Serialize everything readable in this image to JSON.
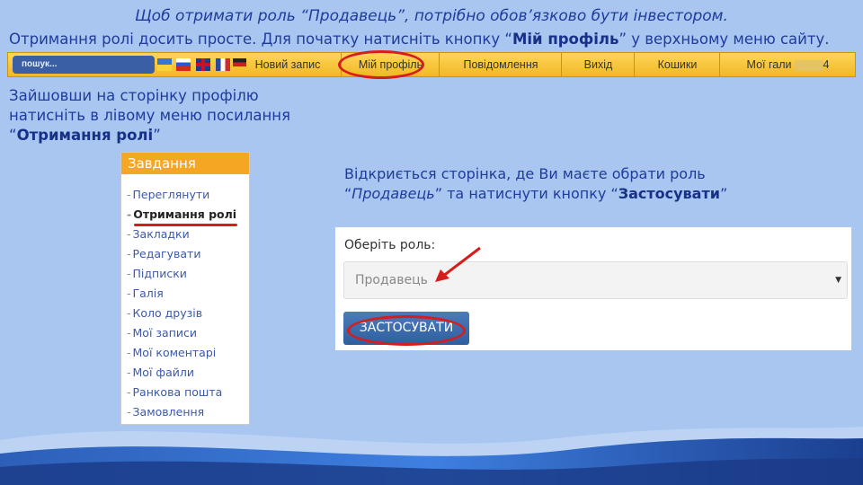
{
  "instructions": {
    "headline": "Щоб отримати роль “Продавець”, потрібно обов’язково бути інвестором.",
    "subline_pre": "Отримання ролі досить просте. Для початку натисніть кнопку “",
    "subline_bold": "Мій профіль",
    "subline_post": "” у верхньому меню сайту.",
    "left_line1": "Зайшовши на сторінку профілю",
    "left_line2": "натисніть в лівому меню посилання",
    "left_line3_pre": "“",
    "left_line3_bold": "Отримання ролі",
    "left_line3_post": "”",
    "right_line1": "Відкриється сторінка, де Ви маєте обрати роль",
    "right_line2_pre": "“",
    "right_line2_italic": "Продавець",
    "right_line2_mid": "” та натиснути кнопку “",
    "right_line2_bold": "Застосувати",
    "right_line2_post": "”"
  },
  "menubar": {
    "search_placeholder": "пошук...",
    "items": [
      {
        "label": "Новий запис"
      },
      {
        "label": "Мій профіль"
      },
      {
        "label": "Повідомлення"
      },
      {
        "label": "Вихід"
      },
      {
        "label": "Кошики"
      },
      {
        "label": "Мої гали",
        "suffix": "4"
      }
    ],
    "flags": [
      "ua",
      "ru",
      "uk",
      "fr",
      "de"
    ]
  },
  "tasks": {
    "header": "Завдання",
    "items": [
      {
        "label": "Переглянути"
      },
      {
        "label": "Отримання ролі",
        "active": true
      },
      {
        "label": "Закладки"
      },
      {
        "label": "Редагувати"
      },
      {
        "label": "Підписки"
      },
      {
        "label": "Галія"
      },
      {
        "label": "Коло друзів"
      },
      {
        "label": "Мої записи"
      },
      {
        "label": "Мої коментарі"
      },
      {
        "label": "Мої файли"
      },
      {
        "label": "Ранкова пошта"
      },
      {
        "label": "Замовлення"
      }
    ]
  },
  "role_form": {
    "label": "Оберіть роль:",
    "selected": "Продавець",
    "apply": "ЗАСТОСУВАТИ"
  },
  "colors": {
    "background": "#a8c6f0",
    "menubar": "#f1b824",
    "highlight": "#d61d1d",
    "tasks_header": "#f5a623",
    "button": "#2f5f9f"
  }
}
